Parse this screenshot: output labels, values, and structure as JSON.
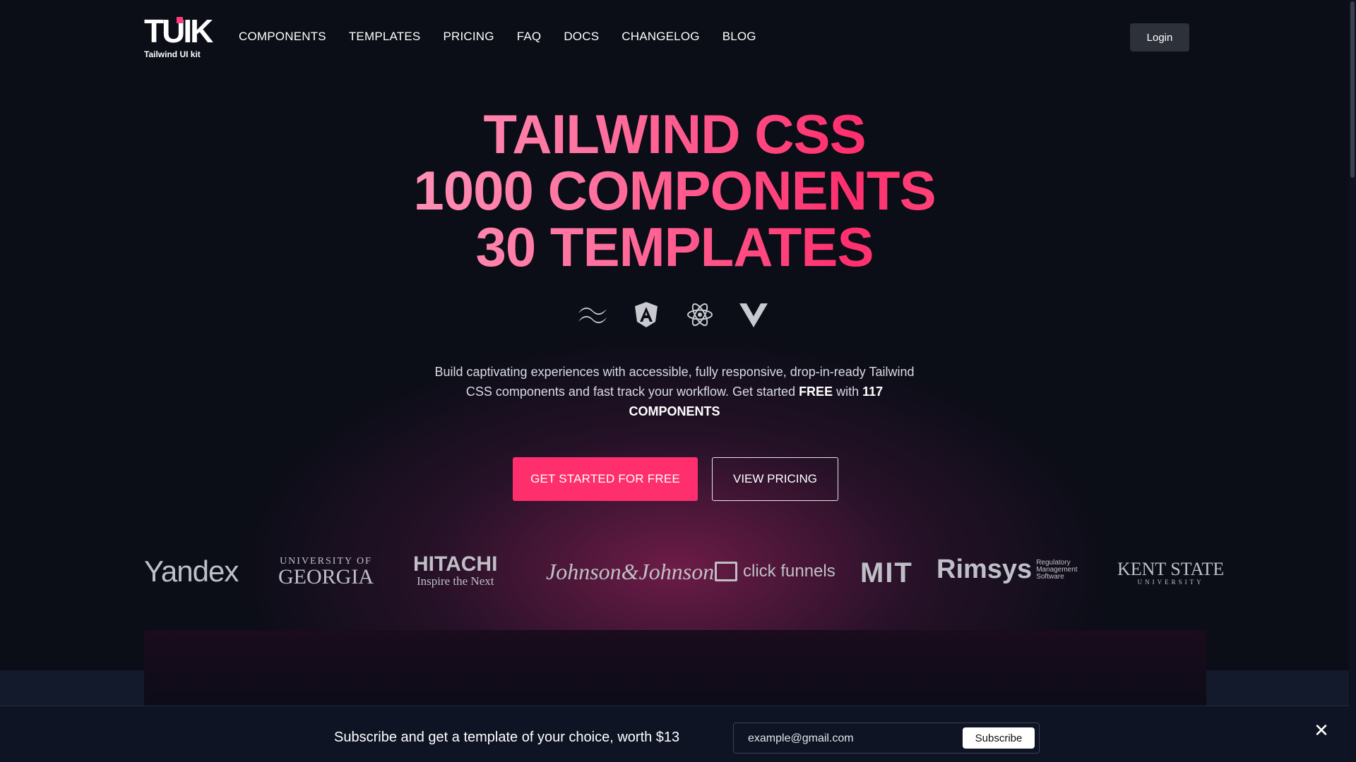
{
  "header": {
    "logo_mark": "TUIK",
    "logo_sub": "Tailwind UI kit",
    "nav": [
      "COMPONENTS",
      "TEMPLATES",
      "PRICING",
      "FAQ",
      "DOCS",
      "CHANGELOG",
      "BLOG"
    ],
    "login_label": "Login"
  },
  "hero": {
    "title_lines": [
      "TAILWIND CSS",
      "1000 COMPONENTS",
      "30 TEMPLATES"
    ],
    "framework_icons": [
      "tailwind-icon",
      "angular-icon",
      "react-icon",
      "vue-icon"
    ],
    "lead_part1": "Build captivating experiences with accessible, fully responsive, drop-in-ready Tailwind CSS components and fast track your workflow. Get started ",
    "lead_free": "FREE",
    "lead_with": " with ",
    "lead_count": "117 COMPONENTS",
    "cta_primary": "GET STARTED FOR FREE",
    "cta_secondary": "VIEW PRICING"
  },
  "clients": {
    "yandex": "Yandex",
    "uga_small": "UNIVERSITY OF",
    "uga_large": "GEORGIA",
    "hitachi": "HITACHI",
    "hitachi_tag": "Inspire the Next",
    "jj": "Johnson&Johnson",
    "clickfunnels": "click funnels",
    "mit": "MIT",
    "rimsys": "Rimsys",
    "rimsys_tag": "Regulatory Management Software",
    "kent": "KENT STATE",
    "kent_sub": "UNIVERSITY"
  },
  "subscribe": {
    "message": "Subscribe and get a template of your choice, worth $13",
    "placeholder": "example@gmail.com",
    "button": "Subscribe",
    "close": "✕"
  },
  "colors": {
    "accent": "#ff2f6d",
    "background": "#0b0d17"
  }
}
